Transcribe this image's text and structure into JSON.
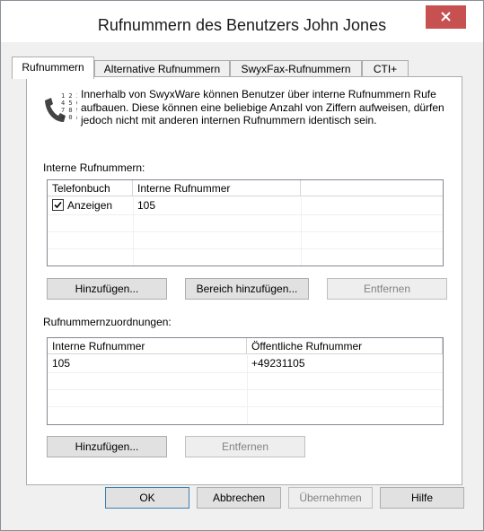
{
  "window": {
    "title": "Rufnummern des Benutzers John Jones"
  },
  "tabs": [
    {
      "label": "Rufnummern",
      "active": true
    },
    {
      "label": "Alternative Rufnummern",
      "active": false
    },
    {
      "label": "SwyxFax-Rufnummern",
      "active": false
    },
    {
      "label": "CTI+",
      "active": false
    }
  ],
  "info": {
    "icon": "phone-keypad-icon",
    "text": "Innerhalb von SwyxWare können Benutzer über interne Rufnummern Rufe aufbauen. Diese können eine beliebige Anzahl von Ziffern aufweisen, dürfen jedoch nicht mit anderen internen Rufnummern identisch sein.",
    "keypad": [
      "1 2 3",
      "4 5 6",
      "7 8 9",
      "✱ 0 #"
    ]
  },
  "internal": {
    "label": "Interne Rufnummern:",
    "columns": [
      "Telefonbuch",
      "Interne Rufnummer",
      ""
    ],
    "rows": [
      {
        "checked": true,
        "phonebook": "Anzeigen",
        "number": "105"
      }
    ],
    "buttons": {
      "add": "Hinzufügen...",
      "add_range": "Bereich hinzufügen...",
      "remove": "Entfernen"
    }
  },
  "mapping": {
    "label": "Rufnummernzuordnungen:",
    "columns": [
      "Interne Rufnummer",
      "Öffentliche Rufnummer"
    ],
    "rows": [
      {
        "internal": "105",
        "public": "+49231105"
      }
    ],
    "buttons": {
      "add": "Hinzufügen...",
      "remove": "Entfernen"
    }
  },
  "footer": {
    "ok": "OK",
    "cancel": "Abbrechen",
    "apply": "Übernehmen",
    "help": "Hilfe"
  },
  "colors": {
    "close_button": "#c75050",
    "panel_bg": "#ffffff",
    "window_bg": "#f0f0f0"
  }
}
